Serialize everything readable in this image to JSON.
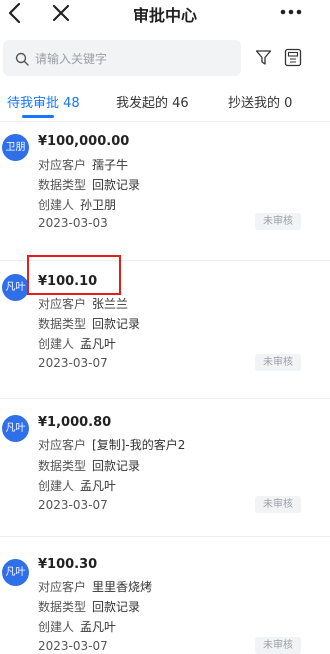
{
  "header": {
    "title": "审批中心",
    "back_icon": "chevron-left-icon",
    "close_icon": "close-icon",
    "more_icon": "more-icon"
  },
  "search": {
    "placeholder": "请输入关键字",
    "filter_icon": "filter-icon",
    "calculator_icon": "calculator-icon"
  },
  "tabs": [
    {
      "label": "待我审批 48",
      "active": true
    },
    {
      "label": "我发起的 46",
      "active": false
    },
    {
      "label": "抄送我的 0",
      "active": false
    }
  ],
  "fields": {
    "customer": "对应客户",
    "type": "数据类型",
    "creator": "创建人"
  },
  "items": [
    {
      "avatar": "卫朋",
      "amount": "¥100,000.00",
      "customer": "孺子牛",
      "type": "回款记录",
      "creator": "孙卫朋",
      "date": "2023-03-03",
      "status": "未审核"
    },
    {
      "avatar": "凡叶",
      "amount": "¥100.10",
      "customer": "张兰兰",
      "type": "回款记录",
      "creator": "孟凡叶",
      "date": "2023-03-07",
      "status": "未审核"
    },
    {
      "avatar": "凡叶",
      "amount": "¥1,000.80",
      "customer": "[复制]-我的客户2",
      "type": "回款记录",
      "creator": "孟凡叶",
      "date": "2023-03-07",
      "status": "未审核"
    },
    {
      "avatar": "凡叶",
      "amount": "¥100.30",
      "customer": "里里香烧烤",
      "type": "回款记录",
      "creator": "孟凡叶",
      "date": "2023-03-07",
      "status": "未审核"
    }
  ],
  "colors": {
    "accent": "#1677ff",
    "avatar": "#2f6fe9",
    "highlight": "#e0201a"
  }
}
